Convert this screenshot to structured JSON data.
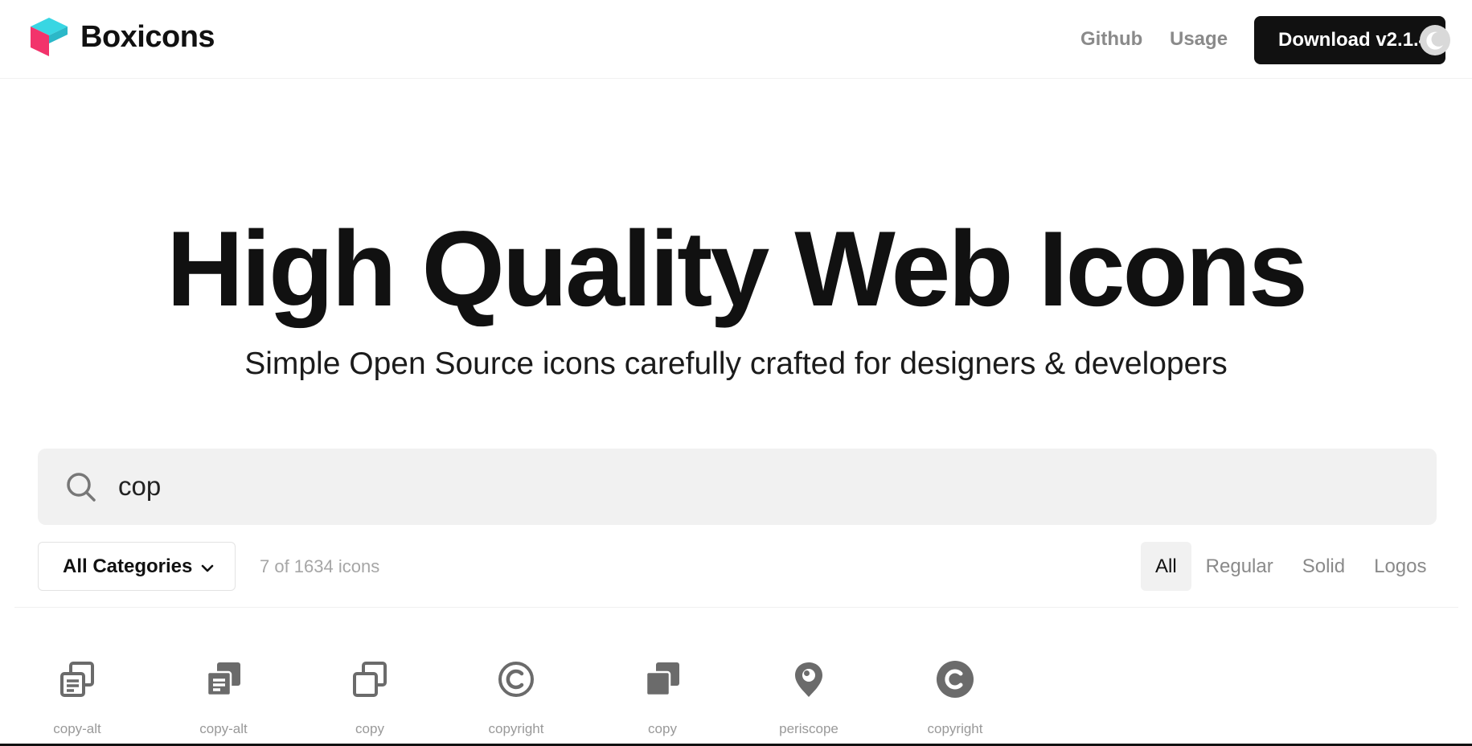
{
  "brand": {
    "name": "Boxicons",
    "colors": {
      "top": "#38d6e3",
      "left": "#f2336b",
      "right": "#b51f55"
    }
  },
  "nav": {
    "github": "Github",
    "usage": "Usage",
    "download": "Download v2.1.4",
    "theme_toggle_icon": "moon-icon"
  },
  "hero": {
    "title": "High Quality Web Icons",
    "subtitle": "Simple Open Source icons carefully crafted for designers & developers"
  },
  "search": {
    "value": "cop",
    "icon": "search-icon"
  },
  "filters": {
    "category": "All Categories",
    "count_text": "7 of 1634 icons",
    "tabs": [
      {
        "label": "All",
        "active": true
      },
      {
        "label": "Regular",
        "active": false
      },
      {
        "label": "Solid",
        "active": false
      },
      {
        "label": "Logos",
        "active": false
      }
    ]
  },
  "results": [
    {
      "name": "copy-alt",
      "icon": "copy-alt-regular-icon"
    },
    {
      "name": "copy-alt",
      "icon": "copy-alt-solid-icon"
    },
    {
      "name": "copy",
      "icon": "copy-regular-icon"
    },
    {
      "name": "copyright",
      "icon": "copyright-regular-icon"
    },
    {
      "name": "copy",
      "icon": "copy-solid-icon"
    },
    {
      "name": "periscope",
      "icon": "periscope-logo-icon"
    },
    {
      "name": "copyright",
      "icon": "copyright-solid-icon"
    }
  ],
  "colors": {
    "text_primary": "#111111",
    "muted": "#8a8a8a",
    "icon_gray": "#6b6b6b",
    "search_bg": "#f1f1f1"
  }
}
